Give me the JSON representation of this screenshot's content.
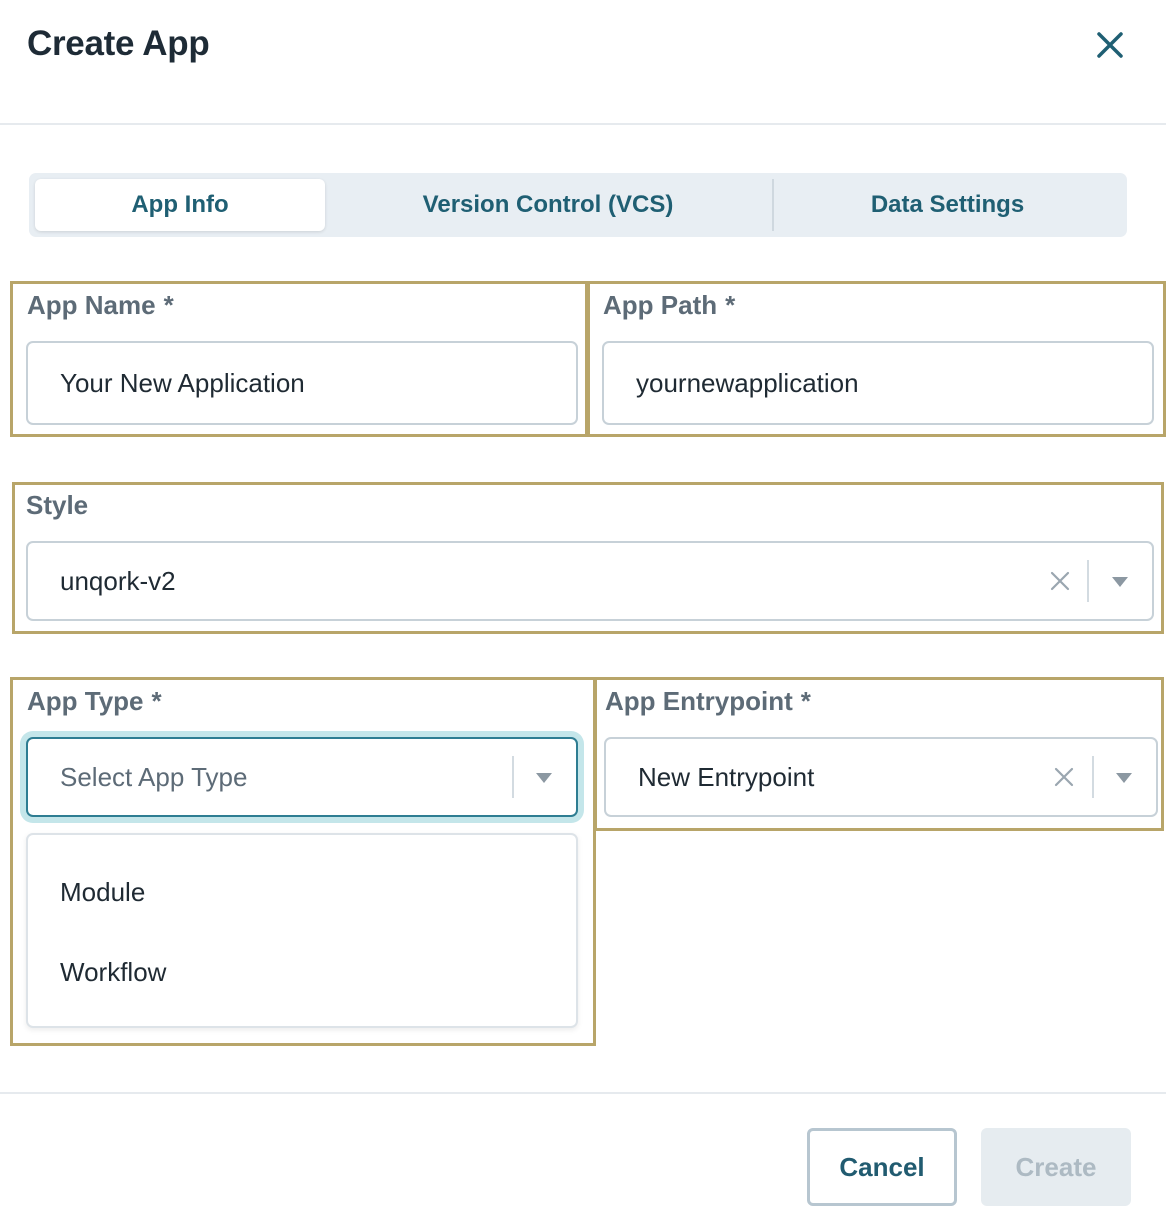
{
  "dialog": {
    "title": "Create App",
    "close_icon": "close-icon"
  },
  "tabs": [
    {
      "label": "App Info",
      "active": true
    },
    {
      "label": "Version Control (VCS)",
      "active": false
    },
    {
      "label": "Data Settings",
      "active": false
    }
  ],
  "fields": {
    "app_name": {
      "label": "App Name",
      "required": "*",
      "value": "Your New Application"
    },
    "app_path": {
      "label": "App Path",
      "required": "*",
      "value": "yournewapplication"
    },
    "style": {
      "label": "Style",
      "value": "unqork-v2"
    },
    "app_type": {
      "label": "App Type",
      "required": "*",
      "placeholder": "Select App Type",
      "options": [
        "Module",
        "Workflow"
      ]
    },
    "app_entrypoint": {
      "label": "App Entrypoint",
      "required": "*",
      "value": "New Entrypoint"
    }
  },
  "footer": {
    "cancel_label": "Cancel",
    "create_label": "Create"
  },
  "colors": {
    "accent": "#1f5f73",
    "highlight_border": "#b8a569",
    "focus_ring": "#c4e6ea",
    "disabled_bg": "#e6ecf0",
    "disabled_text": "#adbac3"
  }
}
